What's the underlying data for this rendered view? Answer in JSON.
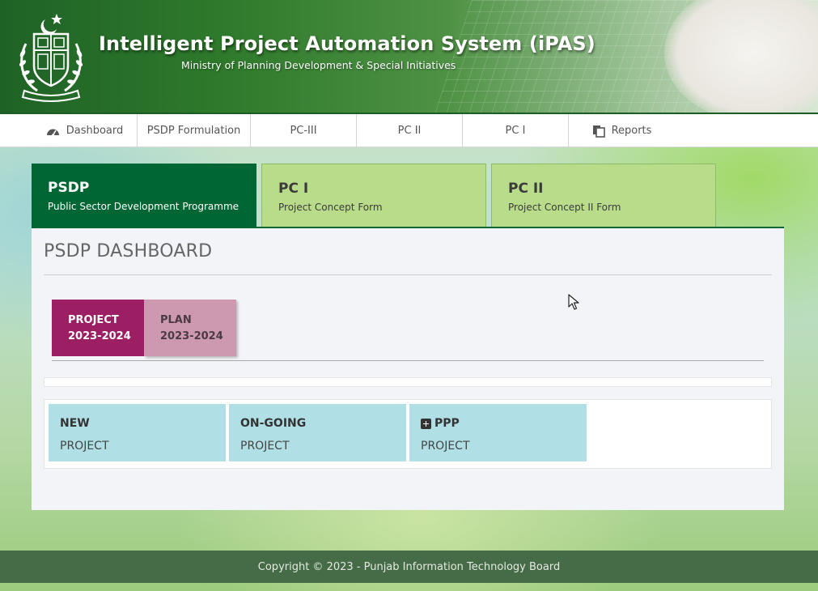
{
  "header": {
    "title": "Intelligent Project Automation System (iPAS)",
    "subtitle": "Ministry of Planning Development & Special Initiatives",
    "emblem_icon": "pakistan-state-emblem"
  },
  "nav": {
    "items": [
      {
        "label": "Dashboard",
        "icon": "dashboard-gauge-icon"
      },
      {
        "label": "PSDP Formulation"
      },
      {
        "label": "PC-III"
      },
      {
        "label": "PC II"
      },
      {
        "label": "PC I"
      },
      {
        "label": "Reports",
        "icon": "copy-documents-icon"
      }
    ]
  },
  "tabs": [
    {
      "title": "PSDP",
      "subtitle": "Public Sector Development Programme",
      "active": true
    },
    {
      "title": "PC I",
      "subtitle": "Project Concept Form",
      "active": false
    },
    {
      "title": "PC II",
      "subtitle": "Project Concept II Form",
      "active": false
    }
  ],
  "dashboard": {
    "title": "PSDP DASHBOARD",
    "pills": [
      {
        "line1": "PROJECT",
        "line2": "2023-2024",
        "active": true
      },
      {
        "line1": "PLAN",
        "line2": "2023-2024",
        "active": false
      }
    ],
    "cards": [
      {
        "title": "NEW",
        "subtitle": "PROJECT"
      },
      {
        "title": "ON-GOING",
        "subtitle": "PROJECT"
      },
      {
        "title": "PPP",
        "subtitle": "PROJECT",
        "icon": "plus-square-icon"
      }
    ]
  },
  "footer": {
    "text": "Copyright © 2023 - Punjab Information Technology Board"
  },
  "colors": {
    "brand_green": "#006633",
    "tab_inactive": "#b8dc8a",
    "pill_active": "#9c1f63",
    "pill_inactive": "#cc99b1",
    "card_bg": "#b0e0e6",
    "footer_bg": "#466b47"
  }
}
